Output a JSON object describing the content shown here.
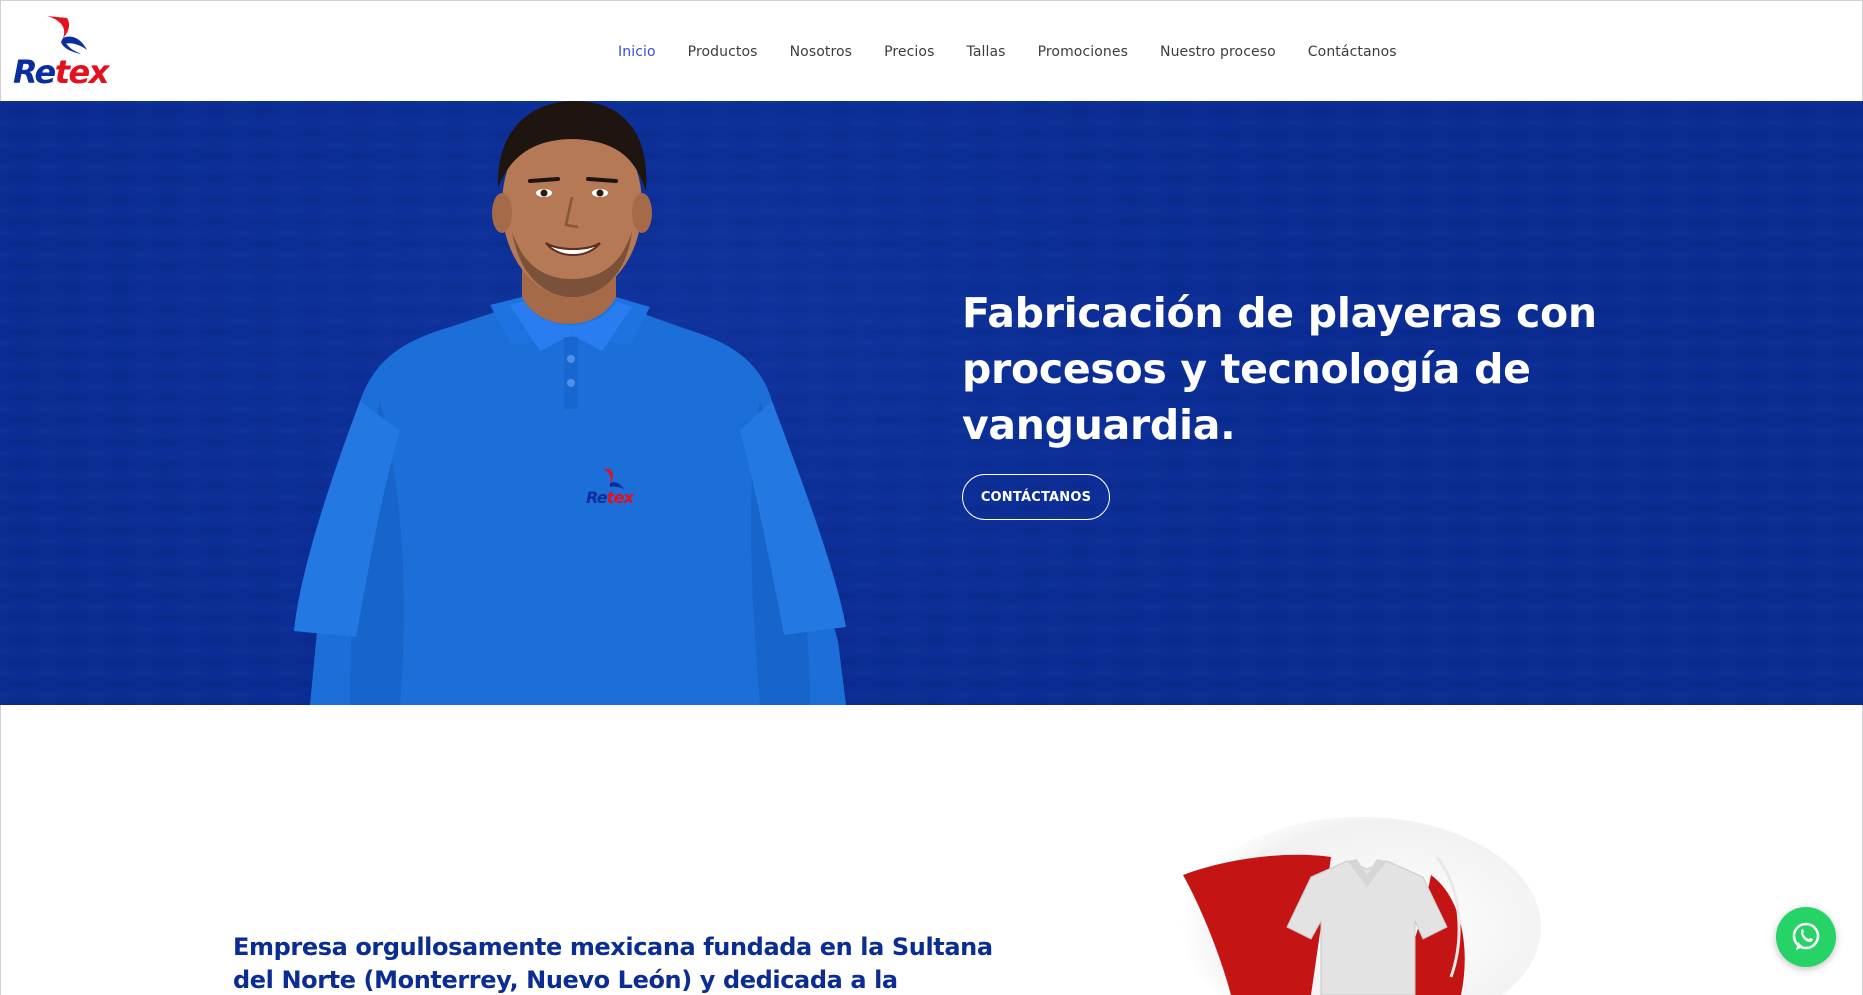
{
  "brand": {
    "logo_text_part1": "Re",
    "logo_text_part2": "tex",
    "colors": {
      "blue": "#0a2ea0",
      "red": "#e3101d"
    }
  },
  "nav": {
    "items": [
      {
        "label": "Inicio",
        "active": true
      },
      {
        "label": "Productos"
      },
      {
        "label": "Nosotros"
      },
      {
        "label": "Precios"
      },
      {
        "label": "Tallas"
      },
      {
        "label": "Promociones"
      },
      {
        "label": "Nuestro proceso"
      },
      {
        "label": "Contáctanos"
      }
    ],
    "active_color": "#3a4fd6"
  },
  "hero": {
    "heading": "Fabricación de playeras con procesos y tecnología de vanguardia.",
    "button_label": "CONTÁCTANOS",
    "background_color": "#0a2c93",
    "shirt_logo_part1": "Re",
    "shirt_logo_part2": "tex"
  },
  "about": {
    "text": "Empresa orgullosamente mexicana fundada en la Sultana del Norte (Monterrey, Nuevo León) y dedicada a la manufactura y"
  },
  "icons": {
    "logo": "reitex-logo-icon",
    "whatsapp": "whatsapp-icon"
  }
}
